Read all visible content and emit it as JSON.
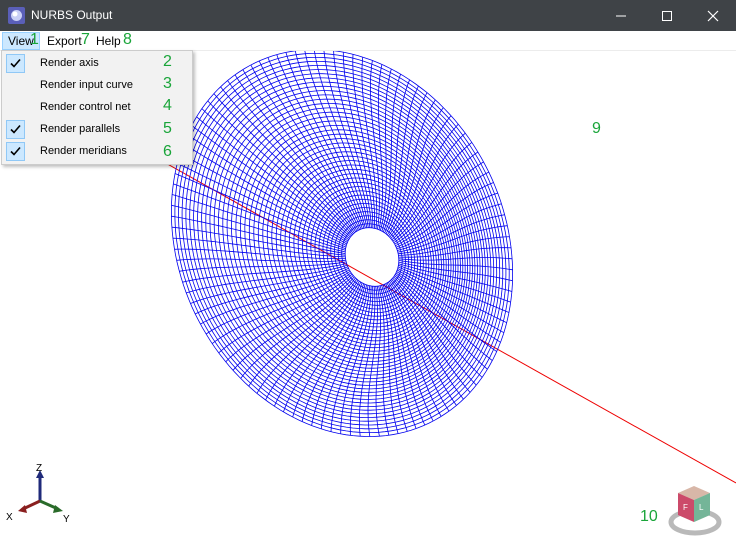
{
  "window": {
    "title": "NURBS Output",
    "minimize_glyph": "—",
    "maximize_glyph": "☐",
    "close_glyph": "✕"
  },
  "menu": {
    "view": "View",
    "export": "Export",
    "help": "Help"
  },
  "view_menu_items": [
    {
      "label": "Render axis",
      "checked": true
    },
    {
      "label": "Render input curve",
      "checked": false
    },
    {
      "label": "Render control net",
      "checked": false
    },
    {
      "label": "Render parallels",
      "checked": true
    },
    {
      "label": "Render meridians",
      "checked": true
    }
  ],
  "annotations": {
    "a1": "1",
    "a2": "2",
    "a3": "3",
    "a4": "4",
    "a5": "5",
    "a6": "6",
    "a7": "7",
    "a8": "8",
    "a9": "9",
    "a10": "10"
  },
  "axes_labels": {
    "z": "Z",
    "x": "X",
    "y": "Y"
  },
  "colors": {
    "mesh": "#0000ee",
    "axis_line": "#ee0000",
    "annotation": "#1aa53a",
    "titlebar": "#3f4347",
    "highlight": "#cce8ff"
  }
}
